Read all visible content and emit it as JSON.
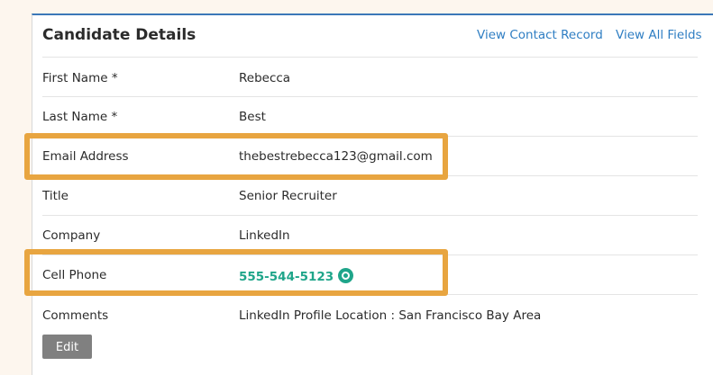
{
  "card": {
    "title": "Candidate Details",
    "links": {
      "view_contact": "View Contact Record",
      "view_all_fields": "View All Fields"
    }
  },
  "fields": {
    "first_name": {
      "label": "First Name *",
      "value": "Rebecca"
    },
    "last_name": {
      "label": "Last Name *",
      "value": "Best"
    },
    "email": {
      "label": "Email Address",
      "value": "thebestrebecca123@gmail.com"
    },
    "title": {
      "label": "Title",
      "value": "Senior Recruiter"
    },
    "company": {
      "label": "Company",
      "value": "LinkedIn"
    },
    "cell_phone": {
      "label": "Cell Phone",
      "value": "555-544-5123"
    },
    "comments": {
      "label": "Comments",
      "value": "LinkedIn Profile Location : San Francisco Bay Area"
    }
  },
  "actions": {
    "edit_label": "Edit"
  },
  "colors": {
    "accent_link": "#2f7ec3",
    "phone_green": "#1fa58a",
    "highlight_orange": "#e8a540",
    "header_rule": "#3b78b8"
  },
  "icons": {
    "phone_action": "circle-search-icon"
  }
}
